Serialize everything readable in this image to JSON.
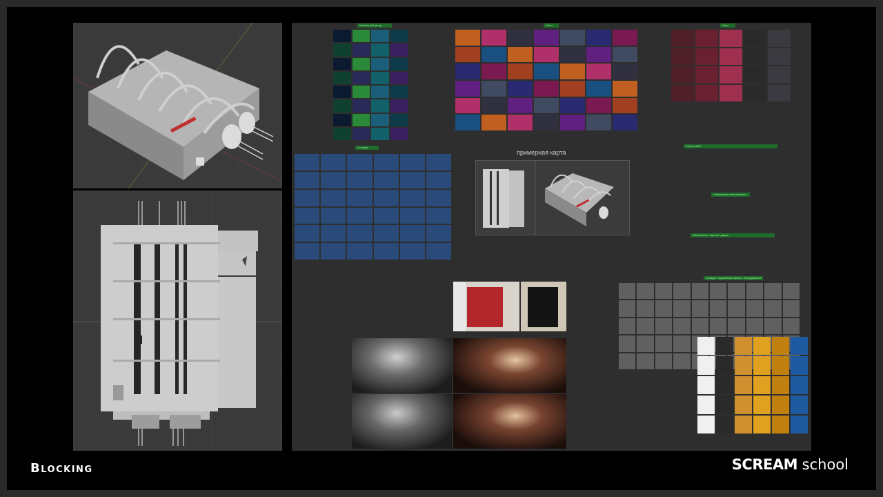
{
  "footer": {
    "title": "Blocking",
    "brand_bold": "SCREAM",
    "brand_light": "school"
  },
  "viewports": {
    "perspective": {
      "name": "3d-perspective-viewport"
    },
    "top": {
      "name": "3d-top-viewport"
    }
  },
  "moodboard": {
    "map_label": "примерная карта",
    "tags": [
      "Комнатный центр",
      "Неон",
      "Игры",
      "Станции",
      "Склады / подъёмные краны / оборудование",
      "Сроки работ",
      "Освещение и настроение",
      "Материалы / ворота / двери"
    ]
  },
  "colors": {
    "frame": "#000000",
    "viewport": "#3a3a3a",
    "board": "#2e2e2e",
    "tag_bg": "#1f6b2a",
    "tag_text": "#9ff29f"
  }
}
